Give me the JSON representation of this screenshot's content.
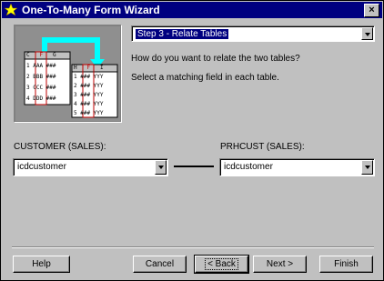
{
  "window": {
    "title": "One-To-Many Form Wizard",
    "close_label": "×"
  },
  "step_select": {
    "value": "Step 3 - Relate Tables"
  },
  "prompt": {
    "question": "How do you want to relate the two tables?",
    "instruction": "Select a matching field in each table."
  },
  "left_table": {
    "label": "CUSTOMER (SALES):",
    "value": "icdcustomer"
  },
  "right_table": {
    "label": "PRHCUST (SALES):",
    "value": "icdcustomer"
  },
  "illustration": {
    "left_headers": [
      "C",
      "F",
      "G"
    ],
    "left_rows": [
      "1 AAA ###",
      "2 BBB ###",
      "3 CCC ###",
      "4 DDD ###"
    ],
    "right_headers": [
      "H",
      "F",
      "I"
    ],
    "right_rows": [
      "1 ### YYY",
      "2 ### YYY",
      "3 ### YYY",
      "4 ### YYY",
      "5 ### YYY"
    ],
    "accent_color": "#00ffff",
    "highlight_color": "#c00000"
  },
  "buttons": {
    "help": "Help",
    "cancel": "Cancel",
    "back": "< Back",
    "next": "Next >",
    "finish": "Finish"
  }
}
